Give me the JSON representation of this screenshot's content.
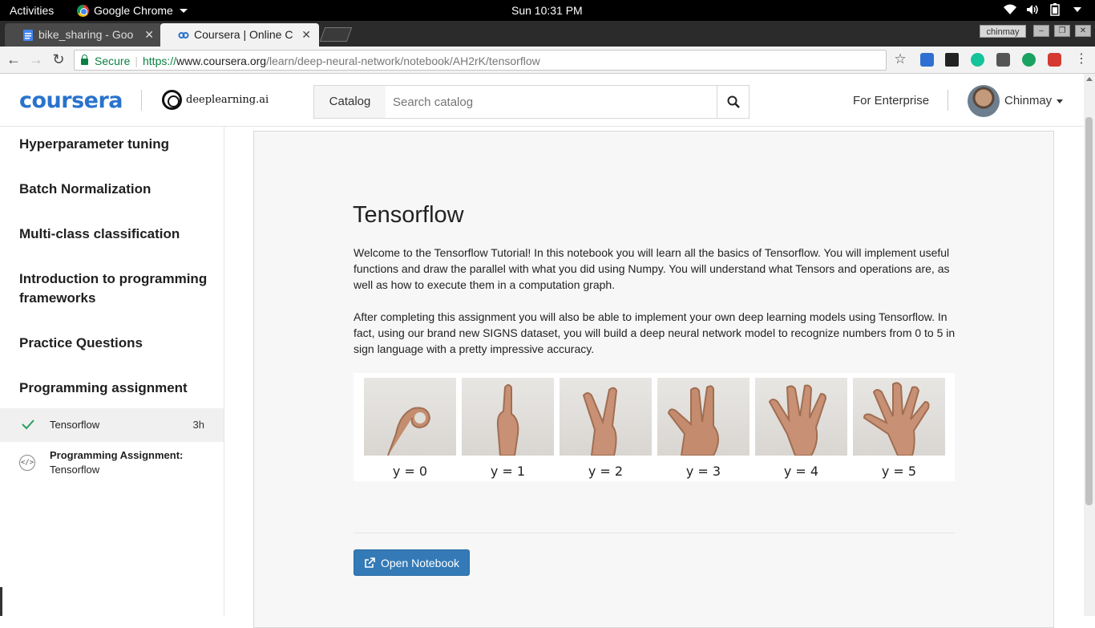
{
  "os_bar": {
    "activities": "Activities",
    "app_name": "Google Chrome",
    "clock": "Sun 10:31 PM"
  },
  "browser": {
    "tabs": [
      {
        "title": "bike_sharing - Goo",
        "active": false
      },
      {
        "title": "Coursera | Online C",
        "active": true
      }
    ],
    "profile": "chinmay",
    "secure_label": "Secure",
    "url_scheme": "https://",
    "url_host": "www.coursera.org",
    "url_path": "/learn/deep-neural-network/notebook/AH2rK/tensorflow"
  },
  "header": {
    "logo": "coursera",
    "partner": "deeplearning.ai",
    "catalog_label": "Catalog",
    "search_placeholder": "Search catalog",
    "enterprise_label": "For Enterprise",
    "username": "Chinmay"
  },
  "sidebar": {
    "sections": [
      "Hyperparameter tuning",
      "Batch Normalization",
      "Multi-class classification",
      "Introduction to programming frameworks",
      "Practice Questions",
      "Programming assignment"
    ],
    "lessons": [
      {
        "label": "Tensorflow",
        "duration": "3h",
        "completed": true
      },
      {
        "title": "Programming Assignment:",
        "subtitle": "Tensorflow"
      }
    ]
  },
  "notebook": {
    "title": "Tensorflow",
    "intro": "Welcome to the Tensorflow Tutorial! In this notebook you will learn all the basics of Tensorflow. You will implement useful functions and draw the parallel with what you did using Numpy. You will understand what Tensors and operations are, as well as how to execute them in a computation graph.",
    "outcome": "After completing this assignment you will also be able to implement your own deep learning models using Tensorflow. In fact, using our brand new SIGNS dataset, you will build a deep neural network model to recognize numbers from 0 to 5 in sign language with a pretty impressive accuracy.",
    "sign_labels": [
      "y = 0",
      "y = 1",
      "y = 2",
      "y = 3",
      "y = 4",
      "y = 5"
    ],
    "open_button": "Open Notebook"
  },
  "colors": {
    "brand": "#2a73cc",
    "button": "#337ab7",
    "check": "#2a9d5c",
    "secure": "#0b8043"
  }
}
